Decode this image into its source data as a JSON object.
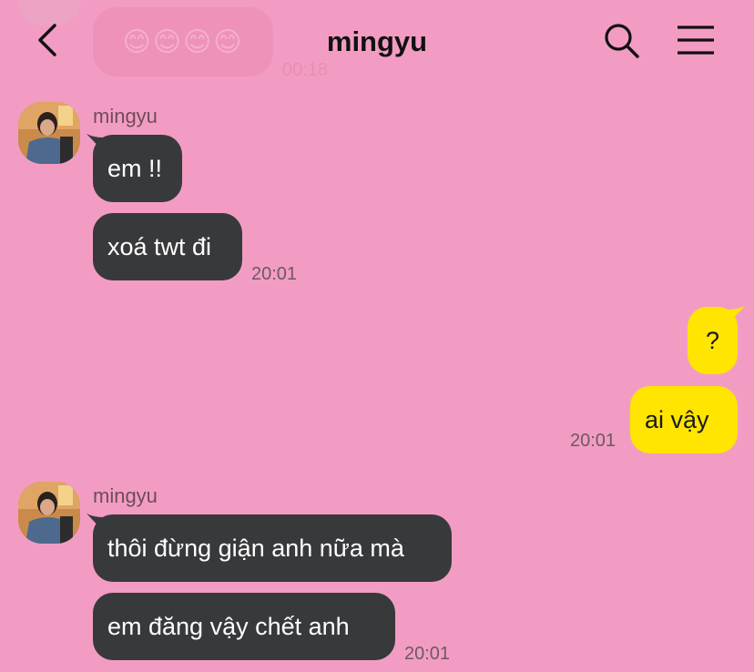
{
  "header": {
    "title": "mingyu"
  },
  "faded": {
    "emoji": "😊😊😊😊",
    "time": "00:18"
  },
  "messages": {
    "group1": {
      "sender": "mingyu",
      "bubble1": "em !!",
      "bubble2": "xoá twt đi",
      "time": "20:01"
    },
    "outgoing": {
      "bubble1": "?",
      "bubble2": "ai vậy",
      "time": "20:01"
    },
    "group2": {
      "sender": "mingyu",
      "bubble1": "thôi đừng giận anh nữa mà",
      "bubble2": "em đăng vậy chết anh",
      "time": "20:01"
    }
  },
  "colors": {
    "background": "#f39cc3",
    "incoming_bubble": "#38393b",
    "outgoing_bubble": "#ffe500"
  },
  "icons": {
    "back": "chevron-left-icon",
    "search": "search-icon",
    "menu": "hamburger-menu-icon"
  }
}
